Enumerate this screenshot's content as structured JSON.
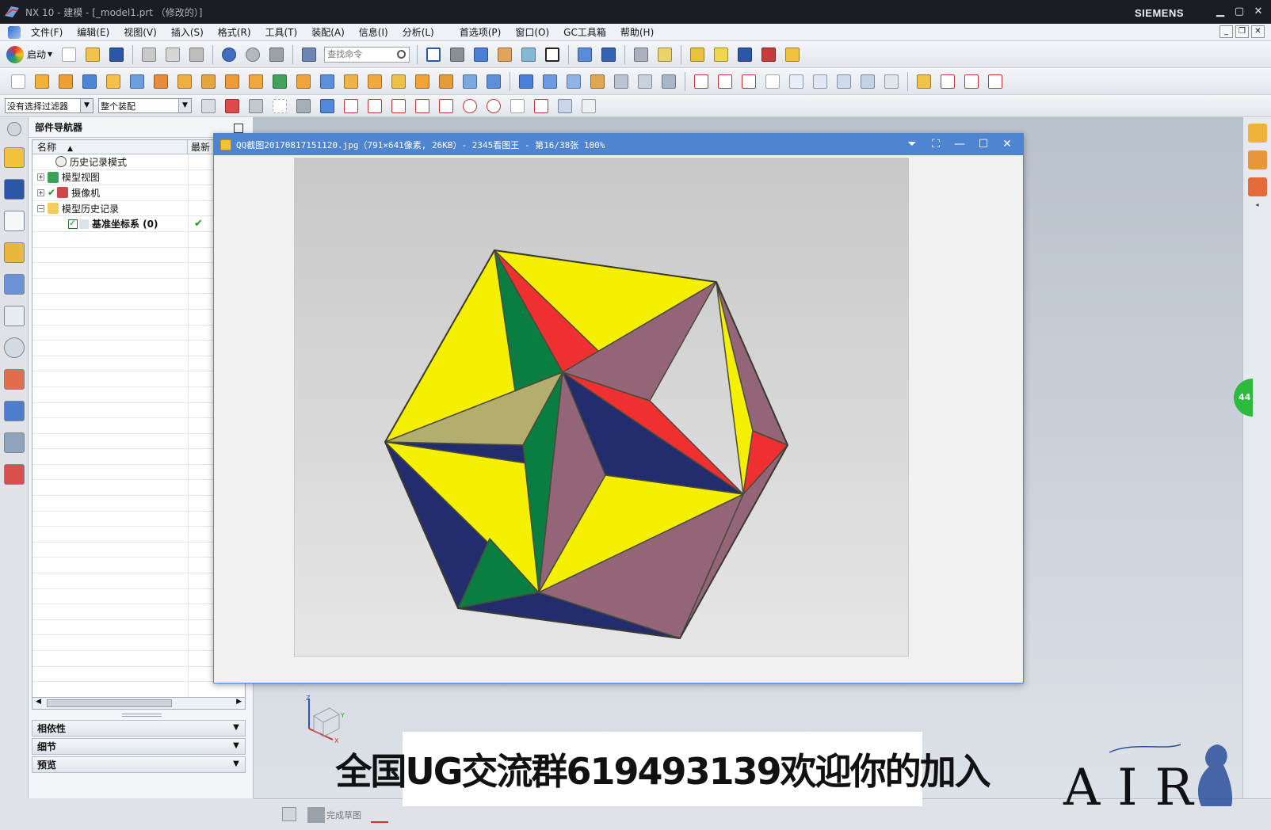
{
  "window": {
    "title": "NX 10 - 建模 - [_model1.prt （修改的）]",
    "brand": "SIEMENS"
  },
  "menu": [
    "文件(F)",
    "编辑(E)",
    "视图(V)",
    "插入(S)",
    "格式(R)",
    "工具(T)",
    "装配(A)",
    "信息(I)",
    "分析(L)",
    "首选项(P)",
    "窗口(O)",
    "GC工具箱",
    "帮助(H)"
  ],
  "toolbar": {
    "start_label": "启动",
    "search_placeholder": "查找命令"
  },
  "selection_bar": {
    "filter_value": "没有选择过滤器",
    "scope_value": "整个装配"
  },
  "navigator": {
    "title": "部件导航器",
    "columns": [
      "名称",
      "最新"
    ],
    "rows": [
      {
        "label": "历史记录模式",
        "expand": "",
        "latest": ""
      },
      {
        "label": "模型视图",
        "expand": "+",
        "latest": ""
      },
      {
        "label": "摄像机",
        "expand": "+",
        "latest": ""
      },
      {
        "label": "模型历史记录",
        "expand": "−",
        "latest": ""
      },
      {
        "label": "基准坐标系 (0)",
        "expand": "",
        "latest": "✔"
      }
    ],
    "sections": [
      "相依性",
      "细节",
      "预览"
    ]
  },
  "viewer": {
    "title": "QQ截图20170817151120.jpg（791×641像素, 26KB）- 2345看图王 - 第16/38张 100%"
  },
  "resource_bar": {
    "badge": "44"
  },
  "status": {
    "sketch_label": "完成草图"
  },
  "banner": {
    "text": "全国UG交流群619493139欢迎你的加入"
  },
  "watermark": {
    "text": "AIR"
  },
  "triad": {
    "x": "X",
    "y": "Y",
    "z": "Z"
  },
  "colors": {
    "yellow": "#f5f000",
    "navy": "#232d6e",
    "mauve": "#946478",
    "green": "#0a7d40",
    "red": "#f03030",
    "olive": "#b3ad6e",
    "viewer_title": "#4f84d1"
  }
}
